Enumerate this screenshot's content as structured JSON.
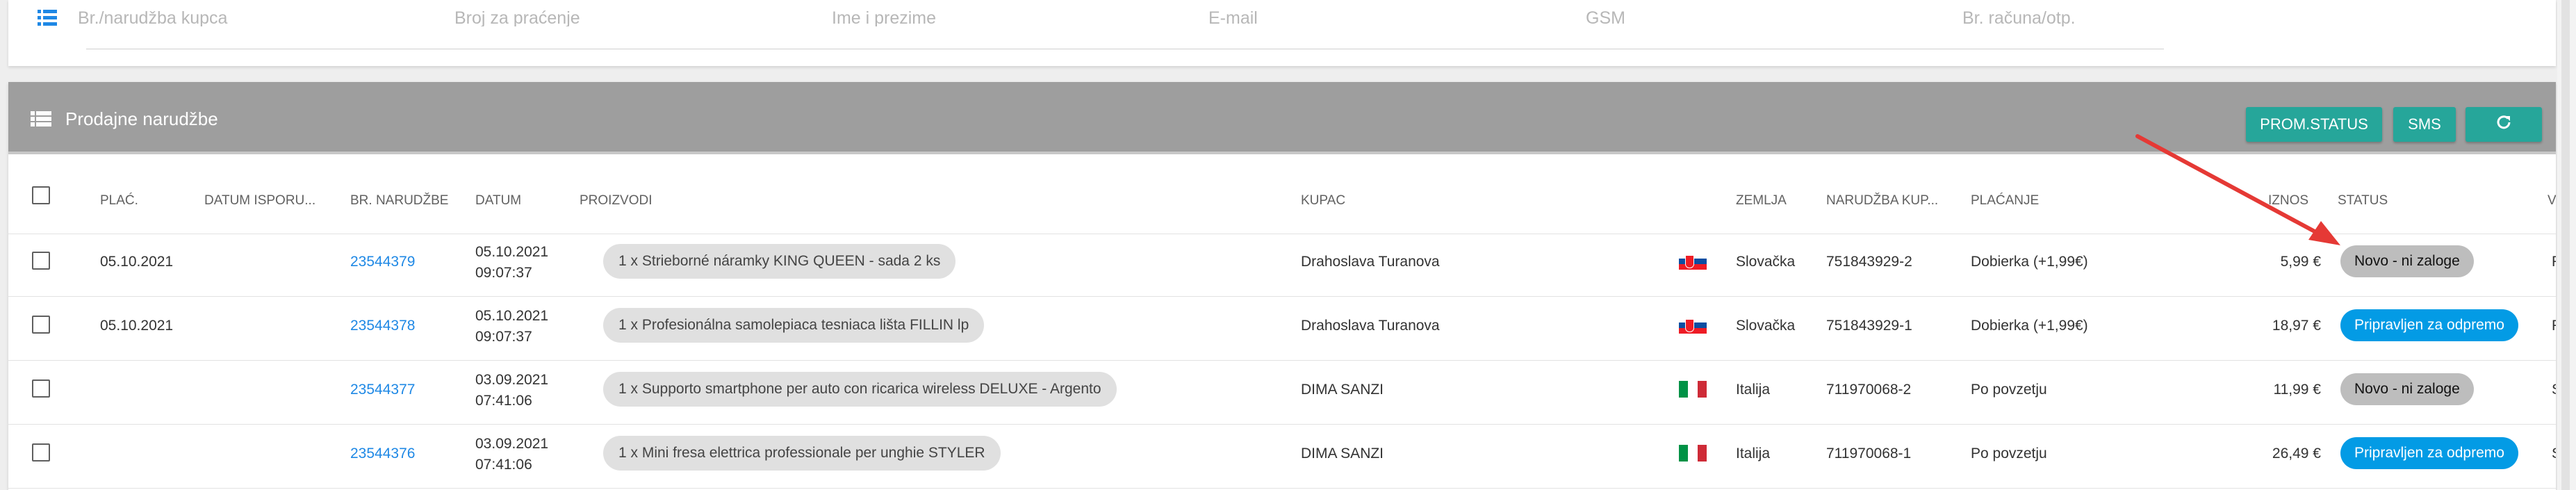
{
  "search": {
    "placeholders": {
      "order_number": "Br./narudžba kupca",
      "tracking": "Broj za praćenje",
      "name": "Ime i prezime",
      "email": "E-mail",
      "gsm": "GSM",
      "invoice": "Br. računa/otp."
    },
    "icon": "list-icon"
  },
  "panel": {
    "title": "Prodajne narudžbe",
    "icon": "table-icon",
    "buttons": {
      "status": "PROM.STATUS",
      "sms": "SMS",
      "refresh_icon": "refresh-icon"
    },
    "header_color": "#9e9e9e",
    "button_color": "#26a69a"
  },
  "table": {
    "columns": {
      "paid": "PLAĆ.",
      "delivery_date": "DATUM ISPORU...",
      "order_no": "BR. NARUDŽBE",
      "date": "DATUM",
      "products": "PROIZVODI",
      "customer": "KUPAC",
      "country": "ZEMLJA",
      "customer_order": "NARUDŽBA KUP...",
      "payment": "PLAĆANJE",
      "amount": "IZNOS",
      "status": "STATUS",
      "extra": "V"
    },
    "rows": [
      {
        "paid": "05.10.2021",
        "order_no": "23544379",
        "date": "05.10.2021",
        "time": "09:07:37",
        "product": "1 x Strieborné náramky KING QUEEN - sada 2 ks",
        "customer": "Drahoslava Turanova",
        "flag": "slovakia-flag",
        "country": "Slovačka",
        "customer_order": "751843929-2",
        "payment": "Dobierka (+1,99€)",
        "amount": "5,99 €",
        "status": "Novo - ni zaloge",
        "extra": "F"
      },
      {
        "paid": "05.10.2021",
        "order_no": "23544378",
        "date": "05.10.2021",
        "time": "09:07:37",
        "product": "1 x Profesionálna samolepiaca tesniaca lišta FILLIN lp",
        "customer": "Drahoslava Turanova",
        "flag": "slovakia-flag",
        "country": "Slovačka",
        "customer_order": "751843929-1",
        "payment": "Dobierka (+1,99€)",
        "amount": "18,97 €",
        "status": "Pripravljen za odpremo",
        "extra": "F"
      },
      {
        "paid": "",
        "order_no": "23544377",
        "date": "03.09.2021",
        "time": "07:41:06",
        "product": "1 x Supporto smartphone per auto con ricarica wireless DELUXE - Argento",
        "customer": "DIMA SANZI",
        "flag": "italy-flag",
        "country": "Italija",
        "customer_order": "711970068-2",
        "payment": "Po povzetju",
        "amount": "11,99 €",
        "status": "Novo - ni zaloge",
        "extra": "S"
      },
      {
        "paid": "",
        "order_no": "23544376",
        "date": "03.09.2021",
        "time": "07:41:06",
        "product": "1 x Mini fresa elettrica professionale per unghie STYLER",
        "customer": "DIMA SANZI",
        "flag": "italy-flag",
        "country": "Italija",
        "customer_order": "711970068-1",
        "payment": "Po povzetju",
        "amount": "26,49 €",
        "status": "Pripravljen za odpremo",
        "extra": "S"
      }
    ]
  },
  "colors": {
    "link": "#1e88e5",
    "status_new": "#bdbdbd",
    "status_ready": "#039be5",
    "annotation_arrow": "#e53935"
  }
}
